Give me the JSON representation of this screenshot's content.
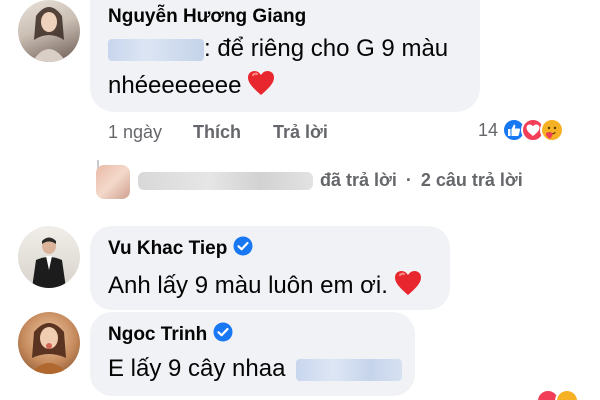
{
  "comment1": {
    "author": "Nguyễn Hương Giang",
    "text_line1": ": để riêng cho G 9 màu",
    "text_line2": "nhéeeeeeee",
    "time": "1 ngày",
    "like_label": "Thích",
    "reply_label": "Trả lời",
    "reaction_count": "14",
    "reaction_icons": [
      "like-icon",
      "love-icon",
      "care-icon"
    ],
    "emoji": "red-heart",
    "replies": {
      "replied_text": "đã trả lời",
      "separator": "·",
      "count_text": "2 câu trả lời"
    }
  },
  "comment2": {
    "author": "Vu Khac Tiep",
    "verified": true,
    "text": "Anh lấy 9 màu luôn em ơi.",
    "emoji": "red-heart"
  },
  "comment3": {
    "author": "Ngoc Trinh",
    "verified": true,
    "text": "E lấy 9 cây nhaa"
  },
  "colors": {
    "bubble": "#f0f2f5",
    "meta": "#65676b",
    "verified": "#1877f2",
    "like": "#1877f2",
    "love": "#f33e58",
    "care": "#f7b125"
  }
}
